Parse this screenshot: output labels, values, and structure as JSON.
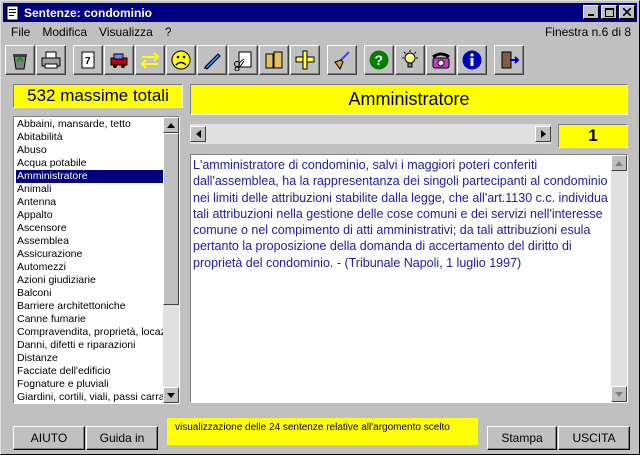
{
  "window": {
    "title": "Sentenze: condominio",
    "window_counter": "Finestra n.6 di 8"
  },
  "menu": {
    "items": [
      {
        "label": "File"
      },
      {
        "label": "Modifica"
      },
      {
        "label": "Visualizza"
      },
      {
        "label": "?"
      }
    ]
  },
  "toolbar": {
    "icons": [
      "recycle-icon",
      "printer-icon",
      "document-list-icon",
      "car-icon",
      "arrows-icon",
      "sad-face-icon",
      "pen-icon",
      "scissors-document-icon",
      "books-icon",
      "ruler-icon",
      "broom-icon",
      "help-icon",
      "lightbulb-icon",
      "telephone-icon",
      "info-icon",
      "exit-door-icon"
    ]
  },
  "totals": {
    "label": "532 massime totali"
  },
  "topic": {
    "title": "Amministratore"
  },
  "pager": {
    "current": "1"
  },
  "topics_list": {
    "items": [
      "Abbaini, mansarde, tetto",
      "Abitabilità",
      "Abuso",
      "Acqua potabile",
      "Amministratore",
      "Animali",
      "Antenna",
      "Appalto",
      "Ascensore",
      "Assemblea",
      "Assicurazione",
      "Automezzi",
      "Azioni giudiziarie",
      "Balconi",
      "Barriere architettoniche",
      "Canne fumarie",
      "Compravendita, proprietà, locaz",
      "Danni, difetti e riparazioni",
      "Distanze",
      "Facciate dell'edificio",
      "Fognature e pluviali",
      "Giardini, cortili, viali, passi carra"
    ],
    "selected": "Amministratore"
  },
  "sentence": {
    "text": "L'amministratore di condominio, salvi i maggiori poteri conferiti dall'assemblea, ha la rappresentanza dei singoli partecipanti al condominio nei limiti delle attribuzioni stabilite dalla legge, che all'art.1130 c.c. individua tali attribuzioni nella gestione delle cose comuni e dei servizi nell'interesse comune o nel compimento di atti amministrativi; da tali attribuzioni esula pertanto la proposizione della domanda di accertamento del diritto di proprietà del condominio. - (Tribunale Napoli, 1 luglio 1997)"
  },
  "footer": {
    "aiuto_label": "AIUTO",
    "guida_label": "Guida in linea",
    "status": "visualizzazione delle  24 sentenze relative all'argomento scelto",
    "stampa_label": "Stampa",
    "uscita_label": "USCITA"
  },
  "colors": {
    "titlebar": "#000080",
    "highlight": "#ffff00",
    "text_blue": "#2020a0",
    "face": "#c0c0c0"
  }
}
